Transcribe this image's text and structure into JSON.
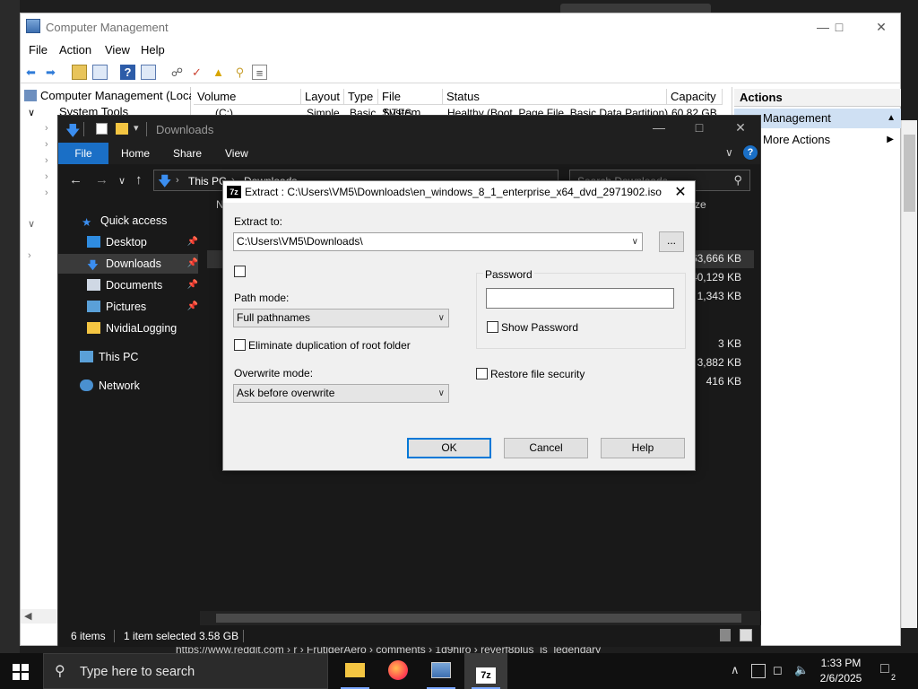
{
  "desktop": {
    "url_hint": "https://www.reddit.com › r › FrutigerAero › comments › 1d9hiro › reverf8plus_is_legendary"
  },
  "cm": {
    "title": "Computer Management",
    "menu": [
      "File",
      "Action",
      "View",
      "Help"
    ],
    "tree_root": "Computer Management (Local",
    "tree_sub": "System Tools",
    "columns": [
      "Volume",
      "Layout",
      "Type",
      "File System",
      "Status",
      "Capacity"
    ],
    "row1": {
      "volume": "(C:)",
      "layout": "Simple",
      "type": "Basic",
      "fs": "NTFS",
      "status": "Healthy (Boot, Page File, Basic Data Partition)",
      "capacity": "60.82 GB"
    },
    "actions_header": "Actions",
    "actions_selected": "Management",
    "actions_more": "More Actions"
  },
  "explorer": {
    "title": "Downloads",
    "tabs": [
      "File",
      "Home",
      "Share",
      "View"
    ],
    "address": [
      "This PC",
      "Downloads"
    ],
    "search_placeholder": "Search Downloads",
    "col_partial_name": "N",
    "col_partial_size": "ze",
    "sidebar": {
      "quick_access": "Quick access",
      "desktop": "Desktop",
      "downloads": "Downloads",
      "documents": "Documents",
      "pictures": "Pictures",
      "nvidia": "NvidiaLogging",
      "thispc": "This PC",
      "network": "Network"
    },
    "sizes": [
      "763,666 KB",
      "40,129 KB",
      "1,343 KB",
      "3 KB",
      "3,882 KB",
      "416 KB"
    ],
    "status_items": "6 items",
    "status_selected": "1 item selected  3.58 GB"
  },
  "dialog": {
    "icon_text": "7z",
    "title": "Extract : C:\\Users\\VM5\\Downloads\\en_windows_8_1_enterprise_x64_dvd_2971902.iso",
    "extract_to_label": "Extract to:",
    "extract_to_value": "C:\\Users\\VM5\\Downloads\\",
    "browse_label": "...",
    "path_mode_label": "Path mode:",
    "path_mode_value": "Full pathnames",
    "eliminate_label": "Eliminate duplication of root folder",
    "overwrite_label": "Overwrite mode:",
    "overwrite_value": "Ask before overwrite",
    "password_label": "Password",
    "show_password_label": "Show Password",
    "restore_label": "Restore file security",
    "ok_label": "OK",
    "cancel_label": "Cancel",
    "help_label": "Help"
  },
  "taskbar": {
    "search_placeholder": "Type here to search",
    "time": "1:33 PM",
    "date": "2/6/2025",
    "notification_count": "2"
  }
}
